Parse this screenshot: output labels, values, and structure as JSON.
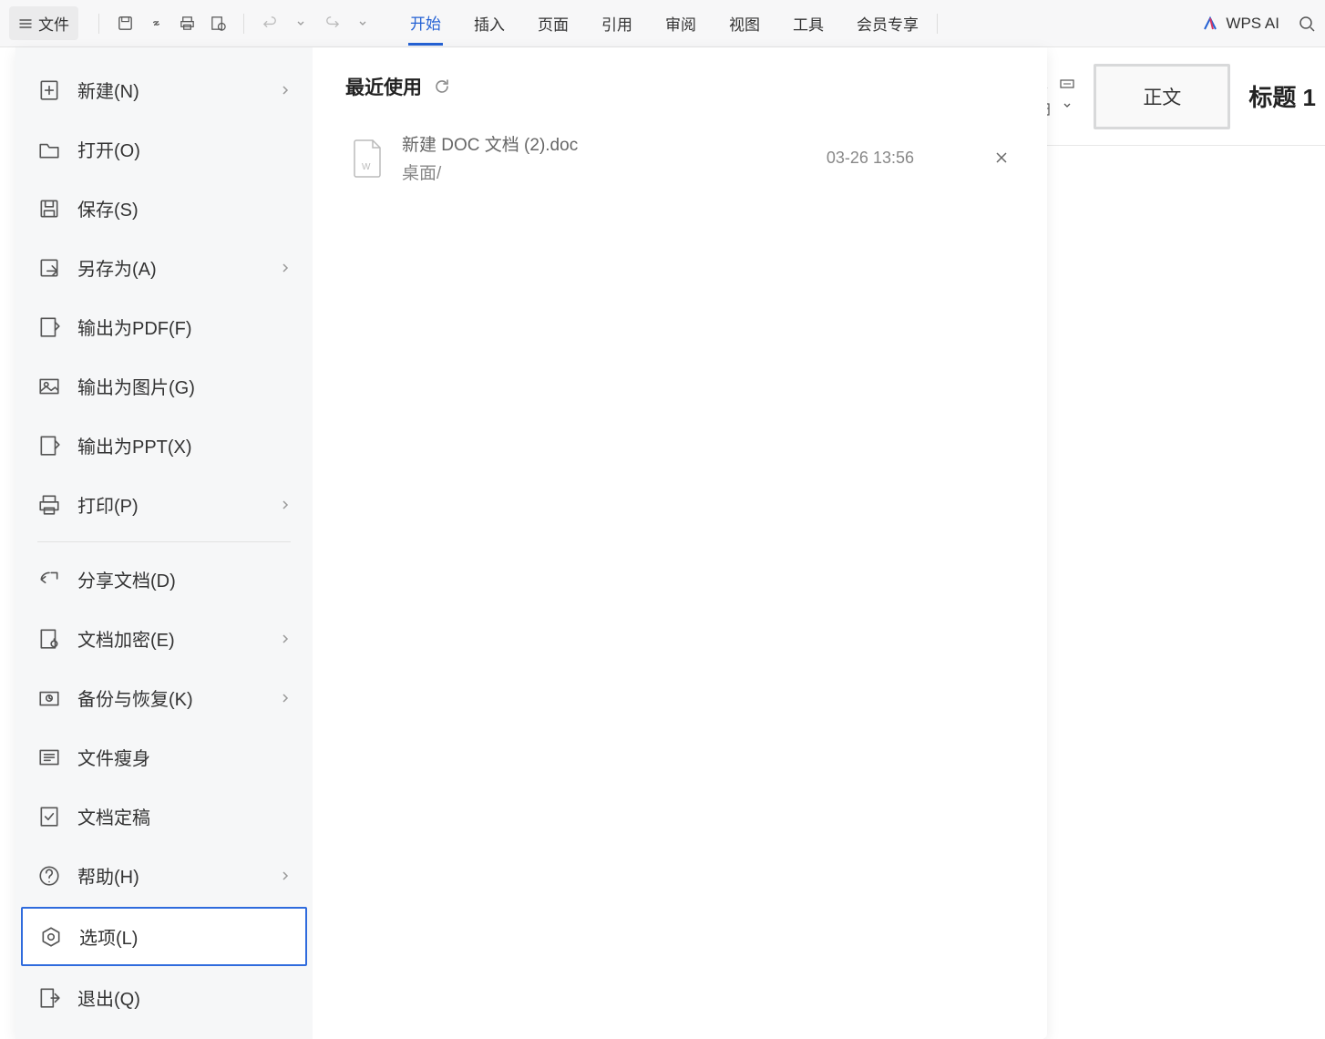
{
  "toolbar": {
    "file_label": "文件",
    "tabs": [
      "开始",
      "插入",
      "页面",
      "引用",
      "审阅",
      "视图",
      "工具",
      "会员专享"
    ],
    "active_tab": 0,
    "wps_ai": "WPS AI"
  },
  "styles": {
    "body_style": "正文",
    "heading_style": "标题 1"
  },
  "menu": {
    "items": [
      {
        "label": "新建(N)",
        "icon": "new",
        "chevron": true
      },
      {
        "label": "打开(O)",
        "icon": "open"
      },
      {
        "label": "保存(S)",
        "icon": "save"
      },
      {
        "label": "另存为(A)",
        "icon": "saveas",
        "chevron": true
      },
      {
        "label": "输出为PDF(F)",
        "icon": "pdf"
      },
      {
        "label": "输出为图片(G)",
        "icon": "image"
      },
      {
        "label": "输出为PPT(X)",
        "icon": "ppt"
      },
      {
        "label": "打印(P)",
        "icon": "print",
        "chevron": true,
        "divider_after": true
      },
      {
        "label": "分享文档(D)",
        "icon": "share"
      },
      {
        "label": "文档加密(E)",
        "icon": "encrypt",
        "chevron": true
      },
      {
        "label": "备份与恢复(K)",
        "icon": "backup",
        "chevron": true
      },
      {
        "label": "文件瘦身",
        "icon": "slim"
      },
      {
        "label": "文档定稿",
        "icon": "finalize"
      },
      {
        "label": "帮助(H)",
        "icon": "help",
        "chevron": true
      },
      {
        "label": "选项(L)",
        "icon": "options",
        "selected": true
      },
      {
        "label": "退出(Q)",
        "icon": "exit"
      }
    ]
  },
  "recent": {
    "title": "最近使用",
    "files": [
      {
        "name": "新建 DOC 文档 (2).doc",
        "path": "桌面/",
        "time": "03-26 13:56"
      }
    ]
  }
}
